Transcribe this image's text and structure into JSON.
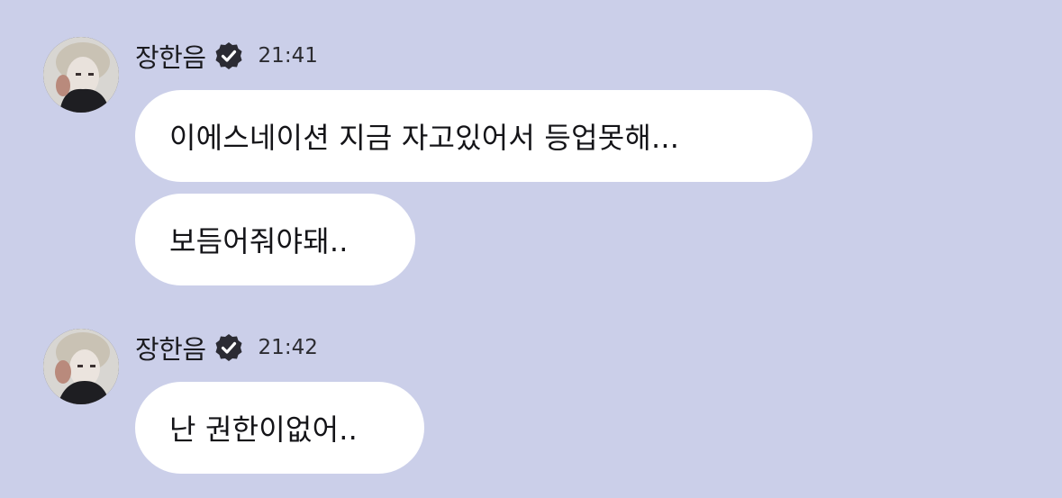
{
  "messages": [
    {
      "sender": "장한음",
      "time": "21:41",
      "bubbles": [
        "이에스네이션 지금 자고있어서 등업못해...",
        "보듬어줘야돼.."
      ]
    },
    {
      "sender": "장한음",
      "time": "21:42",
      "bubbles": [
        "난 권한이없어.."
      ]
    }
  ],
  "icons": {
    "verified": "verified-badge-icon",
    "avatar": "avatar-photo"
  },
  "colors": {
    "background": "#cbcfe9",
    "bubble": "#ffffff",
    "badge": "#2b2b33"
  }
}
